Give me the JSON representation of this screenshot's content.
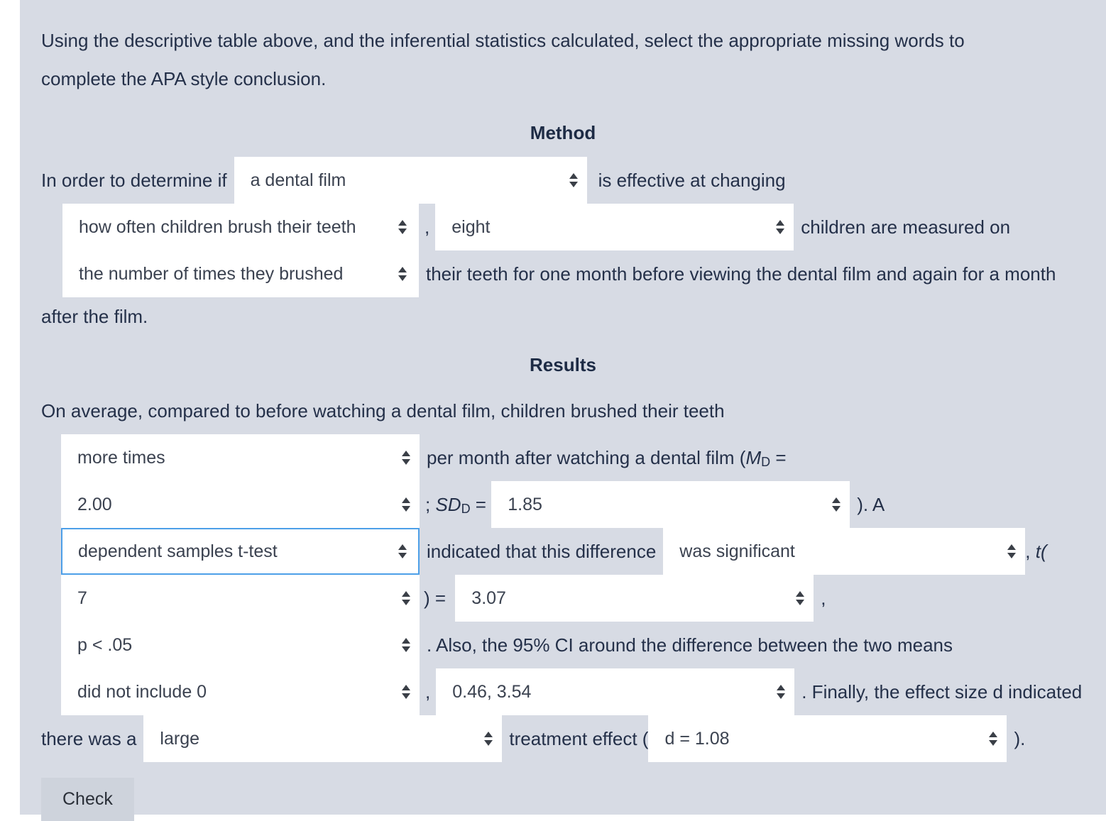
{
  "intro": {
    "line1": "Using the descriptive table above, and the inferential statistics calculated, select the appropriate missing words to",
    "line2": "complete the APA style conclusion."
  },
  "headings": {
    "method": "Method",
    "results": "Results"
  },
  "method": {
    "t1": "In order to determine if",
    "sel_treatment": "a dental film",
    "t2": "is effective at changing",
    "sel_dv": "how often children brush their teeth",
    "t3": ",",
    "sel_n": "eight",
    "t4": "children are measured on",
    "sel_measure": "the number of times they brushed",
    "t5": "their teeth for one month before viewing the dental film and again for a month",
    "t6": "after the film."
  },
  "results": {
    "t1": "On average, compared to before watching a dental film, children brushed their teeth",
    "sel_direction": "more times",
    "t2": "per month after watching a dental film (",
    "md_label": "M",
    "md_sub": "D",
    "t3": " =",
    "sel_md": "2.00",
    "t4": "; ",
    "sd_label": "SD",
    "sd_sub": "D",
    "t5": " = ",
    "sel_sd": "1.85",
    "t6": "). A",
    "sel_test": "dependent samples t-test",
    "t7": "indicated that this difference",
    "sel_sig": "was significant",
    "t8": ", ",
    "t_italic": "t(",
    "sel_df": "7",
    "t9": ") = ",
    "sel_t": "3.07",
    "t10": ",",
    "sel_p": "p < .05",
    "t11": ". Also, the 95% CI around the difference between the two means",
    "sel_ci_include": "did not include 0",
    "t12": ",",
    "sel_ci_values": "0.46, 3.54",
    "t13": ". Finally, the effect size d indicated",
    "t14": "there was a",
    "sel_effect_size": "large",
    "t15": "treatment effect (",
    "sel_d": "d = 1.08",
    "t16": ")."
  },
  "actions": {
    "check_label": "Check"
  },
  "icons": {
    "select_arrow": "chevron-updown-icon"
  },
  "colors": {
    "page_background": "#d7dbe4",
    "text": "#243049",
    "select_background": "#ffffff",
    "select_text": "#3b4250",
    "focus_border": "#4d9fe8",
    "button_background": "#ced3dc"
  }
}
